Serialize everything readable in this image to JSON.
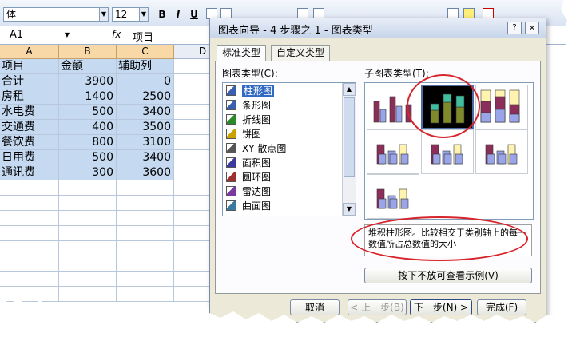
{
  "excel": {
    "font_name": "体",
    "font_size": "12",
    "toolbar": {
      "bold_label": "B",
      "italic_label": "I",
      "underline_label": "U"
    },
    "name_box": "A1",
    "fx_label": "fx",
    "formula_content": "项目",
    "columns": [
      "A",
      "B",
      "C",
      "D"
    ],
    "rows": [
      [
        "项目",
        "金额",
        "辅助列"
      ],
      [
        "合计",
        "3900",
        "0"
      ],
      [
        "房租",
        "1400",
        "2500"
      ],
      [
        "水电费",
        "500",
        "3400"
      ],
      [
        "交通费",
        "400",
        "3500"
      ],
      [
        "餐饮费",
        "800",
        "3100"
      ],
      [
        "日用费",
        "500",
        "3400"
      ],
      [
        "通讯费",
        "300",
        "3600"
      ]
    ]
  },
  "dialog": {
    "title": "图表向导 - 4 步骤之 1 - 图表类型",
    "help_icon": "?",
    "close_icon": "×",
    "tabs": [
      "标准类型",
      "自定义类型"
    ],
    "chart_type_label": "图表类型(C):",
    "subtype_label": "子图表类型(T):",
    "chart_types": [
      {
        "label": "柱形图",
        "icon": "column-chart-icon",
        "selected": true
      },
      {
        "label": "条形图",
        "icon": "bar-chart-icon"
      },
      {
        "label": "折线图",
        "icon": "line-chart-icon"
      },
      {
        "label": "饼图",
        "icon": "pie-chart-icon"
      },
      {
        "label": "XY 散点图",
        "icon": "scatter-chart-icon"
      },
      {
        "label": "面积图",
        "icon": "area-chart-icon"
      },
      {
        "label": "圆环图",
        "icon": "doughnut-chart-icon"
      },
      {
        "label": "雷达图",
        "icon": "radar-chart-icon"
      },
      {
        "label": "曲面图",
        "icon": "surface-chart-icon"
      }
    ],
    "description": "堆积柱形图。比较相交于类别轴上的每一数值所占总数值的大小",
    "preview_button": "按下不放可查看示例(V)",
    "cancel_button": "取消",
    "back_button": "< 上一步(B)",
    "next_button": "下一步(N) >",
    "finish_button": "完成(F)",
    "colors": {
      "accent": "#316ac5",
      "highlight_oval": "#d8232a",
      "selection_fill": "#c5d9f1",
      "header_fill": "#f9d8a8"
    }
  }
}
